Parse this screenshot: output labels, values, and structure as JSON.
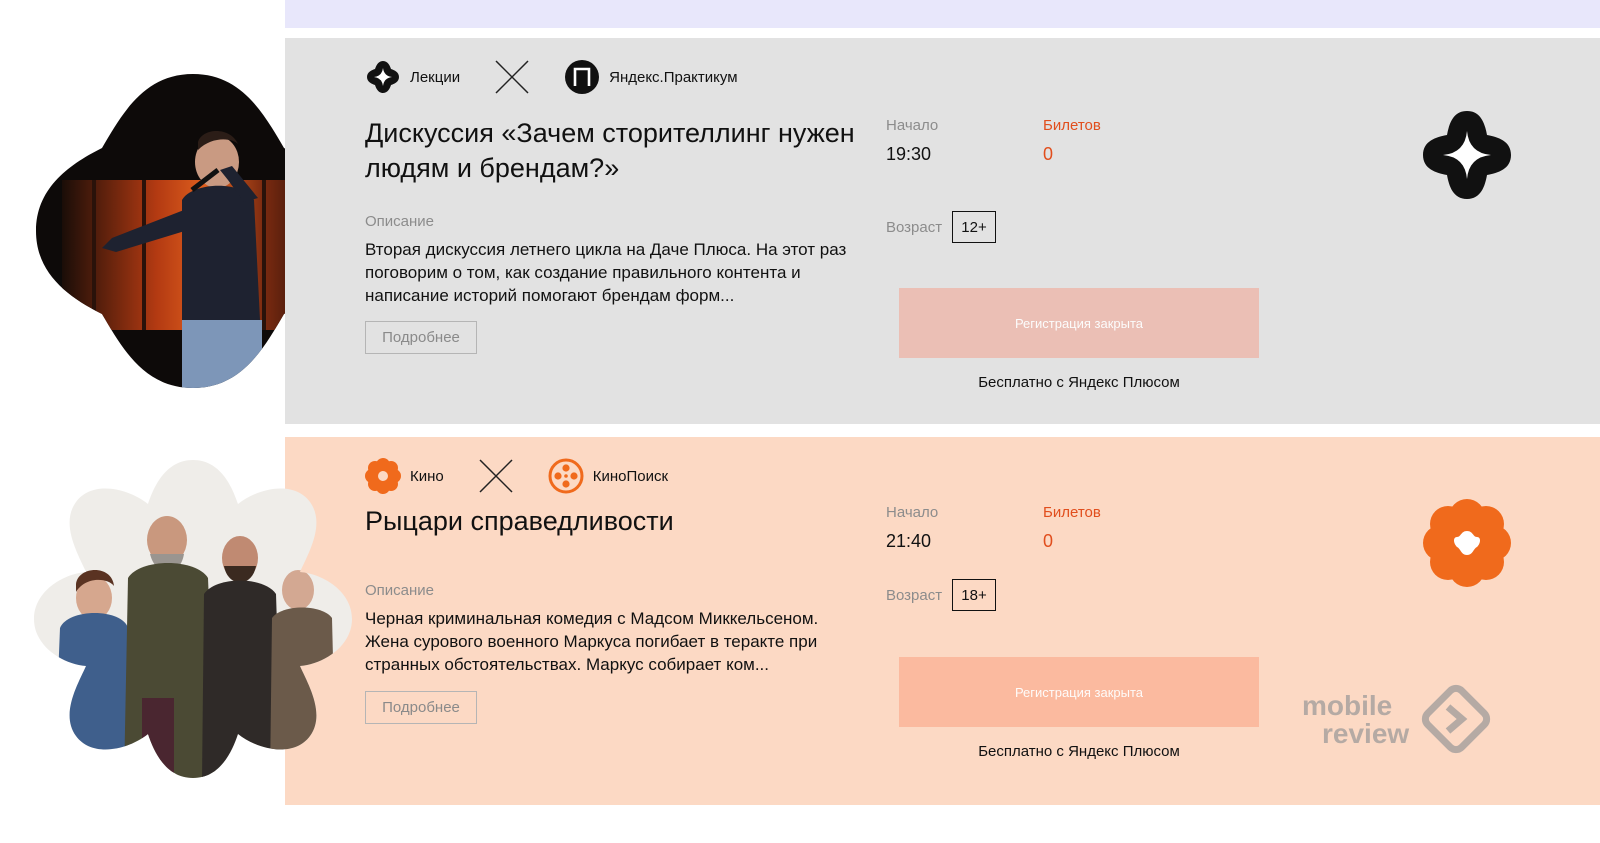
{
  "colors": {
    "lecture_bg": "#e2e2e2",
    "cinema_bg": "#fcd9c4",
    "accent_orange": "#f06a1c",
    "tickets_label": "#e14e1d",
    "top_strip": "#e8e7fb"
  },
  "events": [
    {
      "category": {
        "label": "Лекции",
        "icon": "sparkle-icon"
      },
      "partner": {
        "label": "Яндекс.Практикум",
        "icon": "praktikum-icon"
      },
      "title": "Дискуссия «Зачем сторителлинг нужен людям и брендам?»",
      "description_label": "Описание",
      "description": "Вторая дискуссия летнего цикла на Даче Плюса. На этот раз поговорим о том, как создание правильного контента и написание историй помогают брендам форм...",
      "more_label": "Подробнее",
      "start_label": "Начало",
      "start_time": "19:30",
      "tickets_label": "Билетов",
      "tickets_count": "0",
      "age_label": "Возраст",
      "age_value": "12+",
      "register_label": "Регистрация закрыта",
      "free_note": "Бесплатно с Яндекс Плюсом",
      "badge_icon": "sparkle-badge-icon"
    },
    {
      "category": {
        "label": "Кино",
        "icon": "flower-icon"
      },
      "partner": {
        "label": "КиноПоиск",
        "icon": "film-reel-icon"
      },
      "title": "Рыцари справедливости",
      "description_label": "Описание",
      "description": "Черная криминальная комедия с Мадсом Миккельсеном. Жена сурового военного Маркуса погибает в теракте при странных обстоятельствах. Маркус собирает ком...",
      "more_label": "Подробнее",
      "start_label": "Начало",
      "start_time": "21:40",
      "tickets_label": "Билетов",
      "tickets_count": "0",
      "age_label": "Возраст",
      "age_value": "18+",
      "register_label": "Регистрация закрыта",
      "free_note": "Бесплатно с Яндекс Плюсом",
      "badge_icon": "flower-badge-icon"
    }
  ],
  "watermark": {
    "line1": "mobile",
    "line2": "review"
  }
}
